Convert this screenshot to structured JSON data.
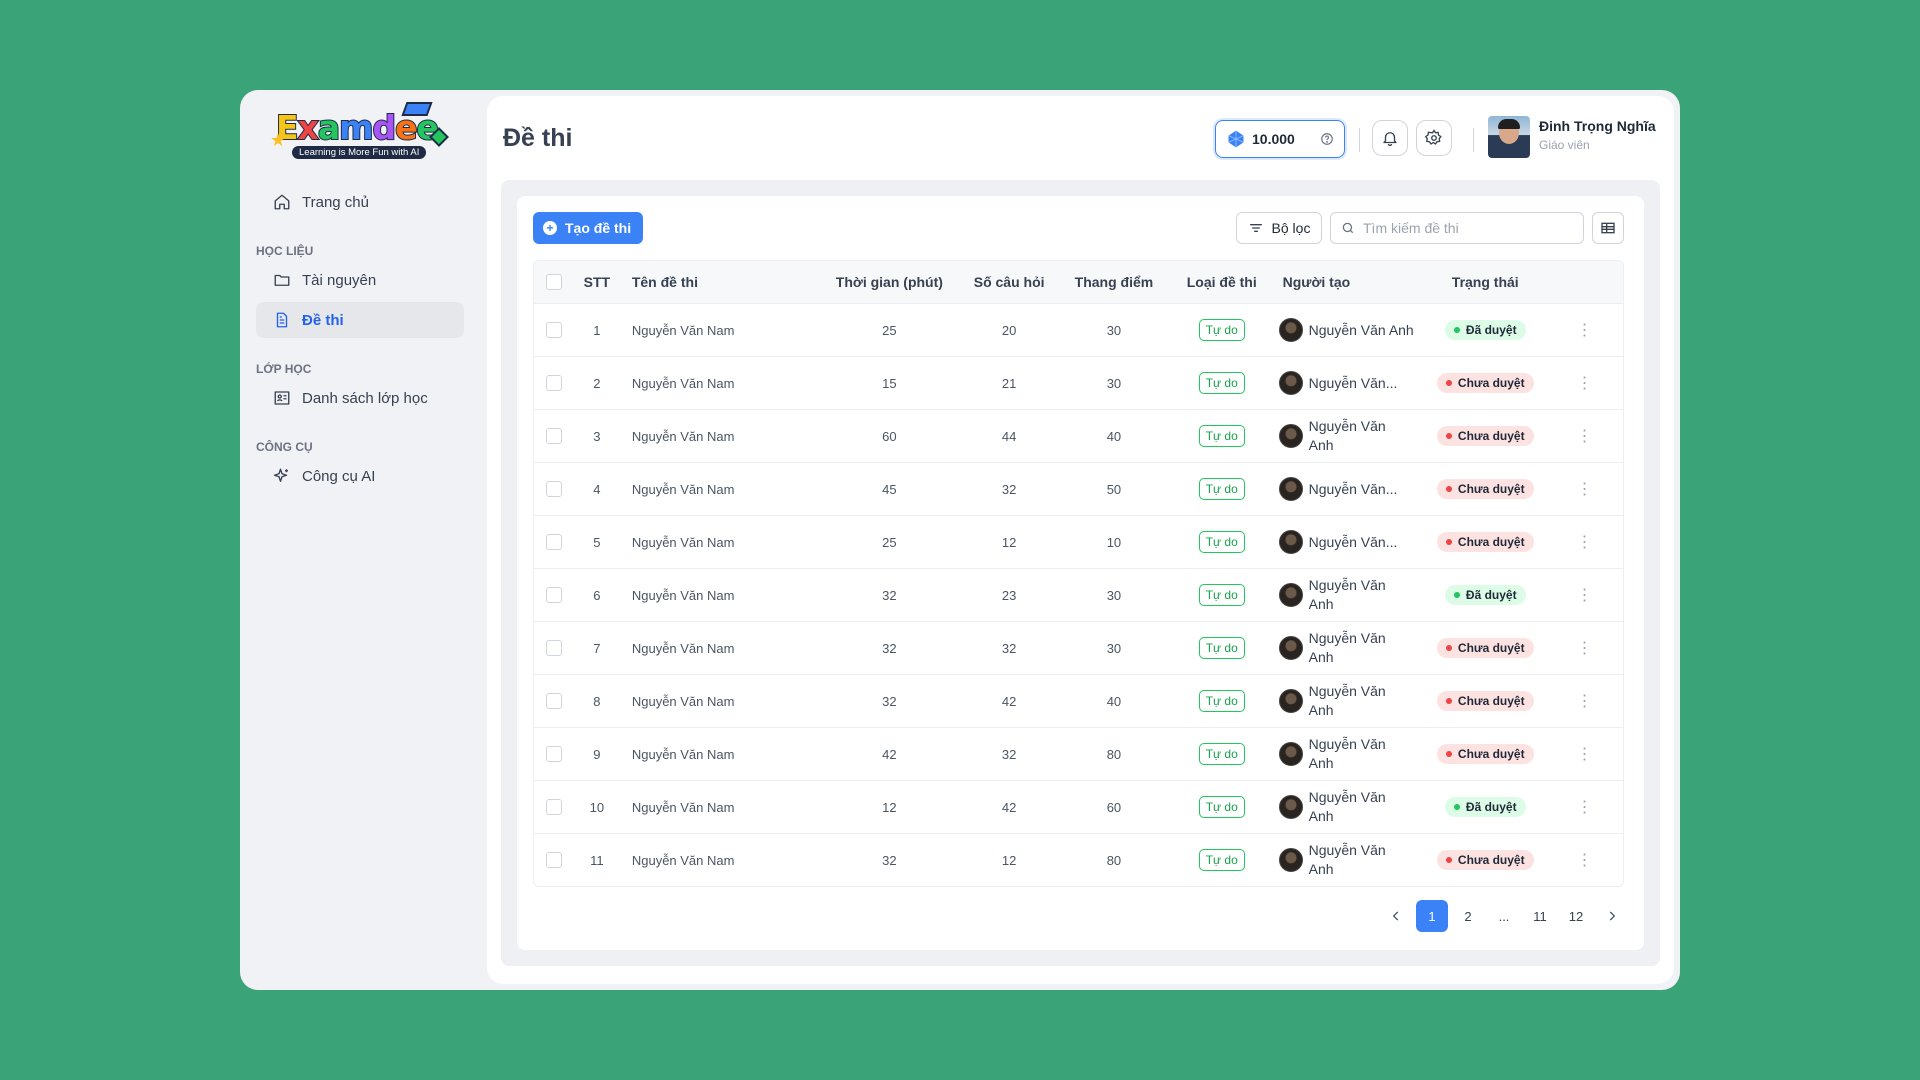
{
  "brand": {
    "name_letters": [
      "E",
      "x",
      "a",
      "m",
      "d",
      "e",
      "e"
    ],
    "name_colors": [
      "#f5c518",
      "#ef4444",
      "#22c55e",
      "#3b82f6",
      "#a855f7",
      "#f97316",
      "#22c55e"
    ],
    "tagline": "Learning is More Fun with AI"
  },
  "sidebar": {
    "home": "Trang chủ",
    "sections": [
      {
        "title": "HỌC LIỆU",
        "items": [
          {
            "label": "Tài nguyên",
            "icon": "folder-icon"
          },
          {
            "label": "Đề thi",
            "icon": "document-icon",
            "active": true
          }
        ]
      },
      {
        "title": "LỚP HỌC",
        "items": [
          {
            "label": "Danh sách lớp học",
            "icon": "classroom-icon"
          }
        ]
      },
      {
        "title": "CÔNG CỤ",
        "items": [
          {
            "label": "Công cụ AI",
            "icon": "sparkle-icon"
          }
        ]
      }
    ]
  },
  "header": {
    "title": "Đề thi",
    "coins": "10.000",
    "user": {
      "name": "Đinh Trọng Nghĩa",
      "role": "Giáo viên"
    }
  },
  "toolbar": {
    "create_label": "Tạo đề thi",
    "filter_label": "Bộ lọc",
    "search_placeholder": "Tìm kiếm đề thi"
  },
  "table": {
    "columns": [
      "STT",
      "Tên đề thi",
      "Thời gian (phút)",
      "Số câu hỏi",
      "Thang điểm",
      "Loại đề thi",
      "Người tạo",
      "Trạng thái"
    ],
    "rows": [
      {
        "stt": "1",
        "name": "Nguyễn Văn Nam",
        "time": "25",
        "questions": "20",
        "score": "30",
        "type": "Tự do",
        "creator": "Nguyễn Văn Anh",
        "creator_display": "full",
        "status": "Đã duyệt",
        "status_kind": "ok"
      },
      {
        "stt": "2",
        "name": "Nguyễn Văn Nam",
        "time": "15",
        "questions": "21",
        "score": "30",
        "type": "Tự do",
        "creator": "Nguyễn Văn...",
        "creator_display": "ellipsis",
        "status": "Chưa duyệt",
        "status_kind": "pending"
      },
      {
        "stt": "3",
        "name": "Nguyễn Văn Nam",
        "time": "60",
        "questions": "44",
        "score": "40",
        "type": "Tự do",
        "creator": "Nguyễn Văn Anh",
        "creator_display": "wrap",
        "status": "Chưa duyệt",
        "status_kind": "pending"
      },
      {
        "stt": "4",
        "name": "Nguyễn Văn Nam",
        "time": "45",
        "questions": "32",
        "score": "50",
        "type": "Tự do",
        "creator": "Nguyễn Văn...",
        "creator_display": "ellipsis",
        "status": "Chưa duyệt",
        "status_kind": "pending"
      },
      {
        "stt": "5",
        "name": "Nguyễn Văn Nam",
        "time": "25",
        "questions": "12",
        "score": "10",
        "type": "Tự do",
        "creator": "Nguyễn Văn...",
        "creator_display": "ellipsis",
        "status": "Chưa duyệt",
        "status_kind": "pending"
      },
      {
        "stt": "6",
        "name": "Nguyễn Văn Nam",
        "time": "32",
        "questions": "23",
        "score": "30",
        "type": "Tự do",
        "creator": "Nguyễn Văn Anh",
        "creator_display": "wrap",
        "status": "Đã duyệt",
        "status_kind": "ok"
      },
      {
        "stt": "7",
        "name": "Nguyễn Văn Nam",
        "time": "32",
        "questions": "32",
        "score": "30",
        "type": "Tự do",
        "creator": "Nguyễn Văn Anh",
        "creator_display": "wrap",
        "status": "Chưa duyệt",
        "status_kind": "pending"
      },
      {
        "stt": "8",
        "name": "Nguyễn Văn Nam",
        "time": "32",
        "questions": "42",
        "score": "40",
        "type": "Tự do",
        "creator": "Nguyễn Văn Anh",
        "creator_display": "wrap",
        "status": "Chưa duyệt",
        "status_kind": "pending"
      },
      {
        "stt": "9",
        "name": "Nguyễn Văn Nam",
        "time": "42",
        "questions": "32",
        "score": "80",
        "type": "Tự do",
        "creator": "Nguyễn Văn Anh",
        "creator_display": "wrap",
        "status": "Chưa duyệt",
        "status_kind": "pending"
      },
      {
        "stt": "10",
        "name": "Nguyễn Văn Nam",
        "time": "12",
        "questions": "42",
        "score": "60",
        "type": "Tự do",
        "creator": "Nguyễn Văn Anh",
        "creator_display": "wrap",
        "status": "Đã duyệt",
        "status_kind": "ok"
      },
      {
        "stt": "11",
        "name": "Nguyễn Văn Nam",
        "time": "32",
        "questions": "12",
        "score": "80",
        "type": "Tự do",
        "creator": "Nguyễn Văn Anh",
        "creator_display": "wrap",
        "status": "Chưa duyệt",
        "status_kind": "pending"
      }
    ]
  },
  "pagination": {
    "pages": [
      "1",
      "2",
      "...",
      "11",
      "12"
    ],
    "current": "1"
  },
  "colors": {
    "accent": "#3b82f6",
    "background": "#3ba378",
    "ok": "#22c55e",
    "pending": "#ef4444"
  }
}
